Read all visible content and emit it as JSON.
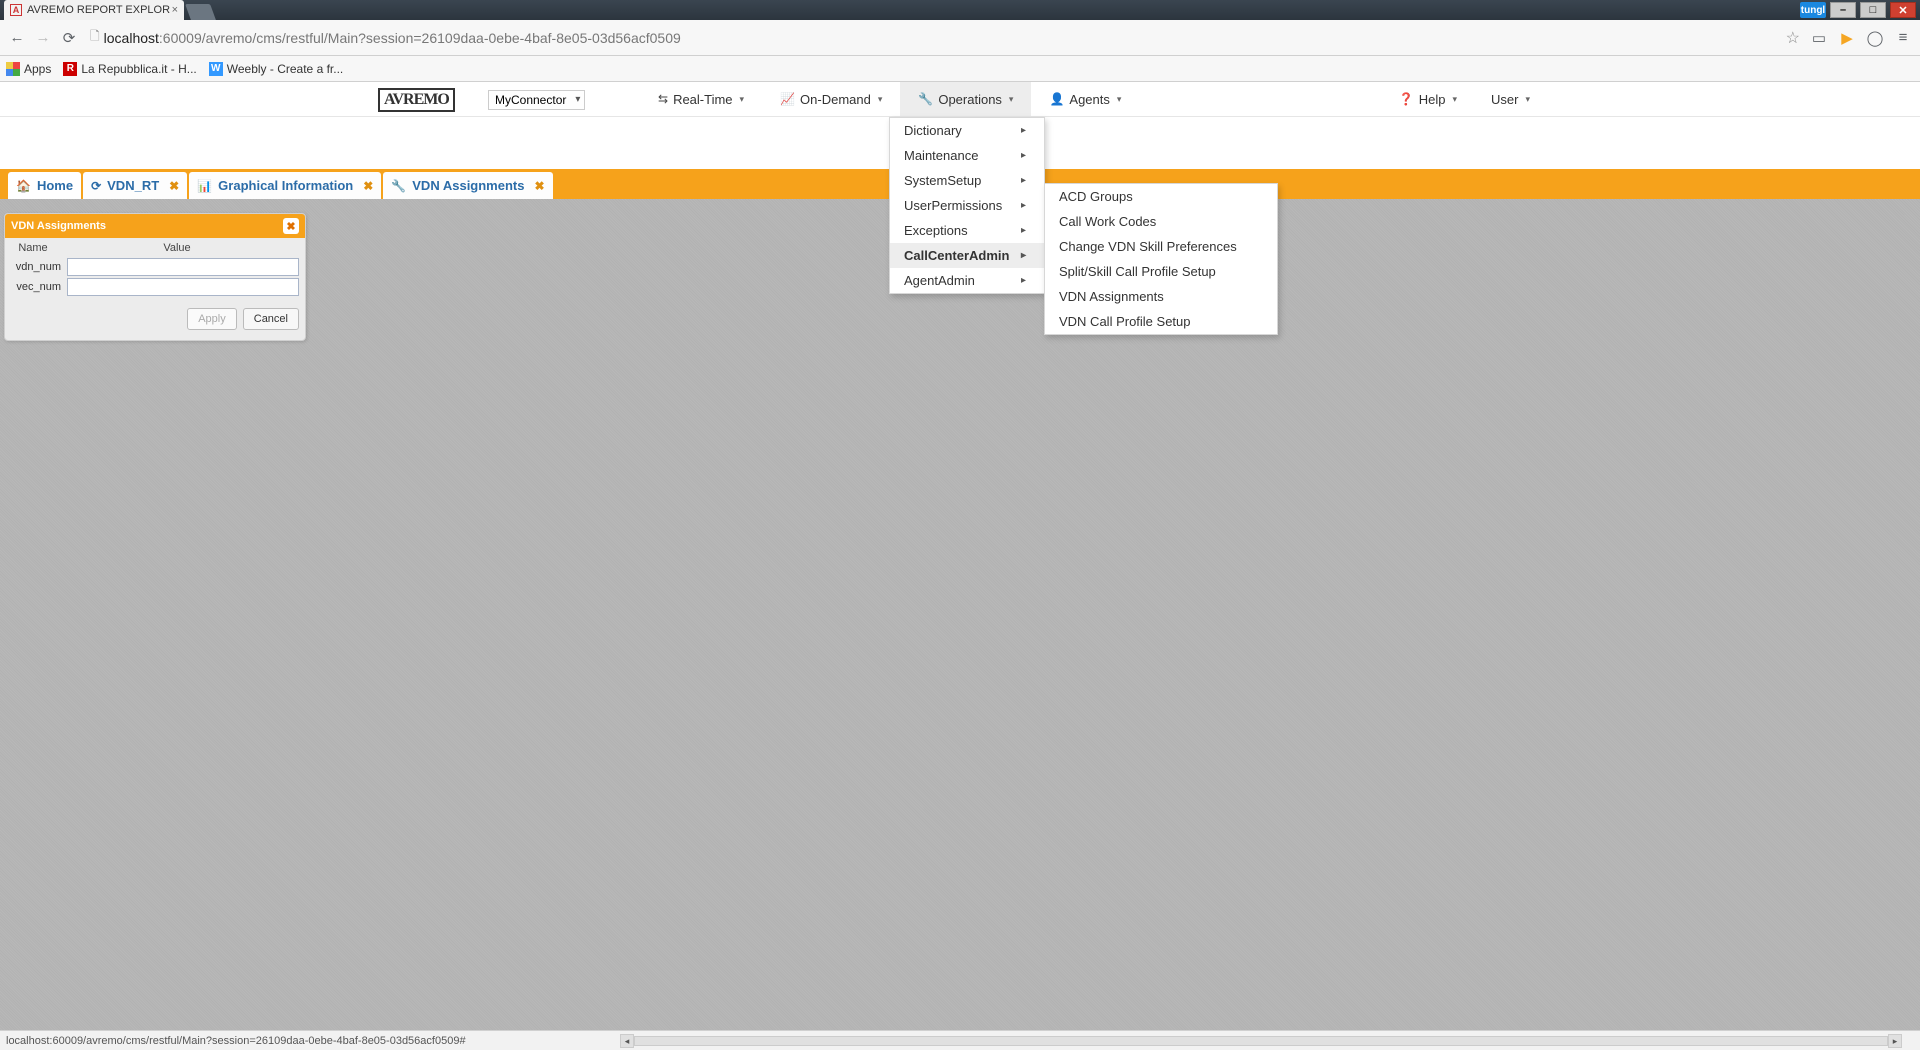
{
  "browser": {
    "tab_title": "AVREMO REPORT EXPLOR",
    "url_host": "localhost",
    "url_port": ":60009",
    "url_path": "/avremo/cms/restful/Main?session=26109daa-0ebe-4baf-8e05-03d56acf0509",
    "lang_badge": "tungl",
    "bookmarks": {
      "apps": "Apps",
      "repubblica": "La Repubblica.it - H...",
      "weebly": "Weebly - Create a fr..."
    }
  },
  "menubar": {
    "logo": "AVREMO",
    "connector": "MyConnector",
    "items": {
      "realtime": "Real-Time",
      "ondemand": "On-Demand",
      "operations": "Operations",
      "agents": "Agents"
    },
    "right": {
      "help": "Help",
      "user": "User"
    }
  },
  "tabs": [
    {
      "icon": "home",
      "label": "Home",
      "closable": false
    },
    {
      "icon": "refresh",
      "label": "VDN_RT",
      "closable": true
    },
    {
      "icon": "chart",
      "label": "Graphical Information",
      "closable": true
    },
    {
      "icon": "wrench",
      "label": "VDN Assignments",
      "closable": true
    }
  ],
  "operations_menu": [
    "Dictionary",
    "Maintenance",
    "SystemSetup",
    "UserPermissions",
    "Exceptions",
    "CallCenterAdmin",
    "AgentAdmin"
  ],
  "callcenteradmin_submenu": [
    "ACD Groups",
    "Call Work Codes",
    "Change VDN Skill Preferences",
    "Split/Skill Call Profile Setup",
    "VDN Assignments",
    "VDN Call Profile Setup"
  ],
  "dialog": {
    "title": "VDN Assignments",
    "name_header": "Name",
    "value_header": "Value",
    "fields": [
      {
        "label": "vdn_num",
        "value": ""
      },
      {
        "label": "vec_num",
        "value": ""
      }
    ],
    "apply": "Apply",
    "cancel": "Cancel"
  },
  "status_text": "localhost:60009/avremo/cms/restful/Main?session=26109daa-0ebe-4baf-8e05-03d56acf0509#"
}
